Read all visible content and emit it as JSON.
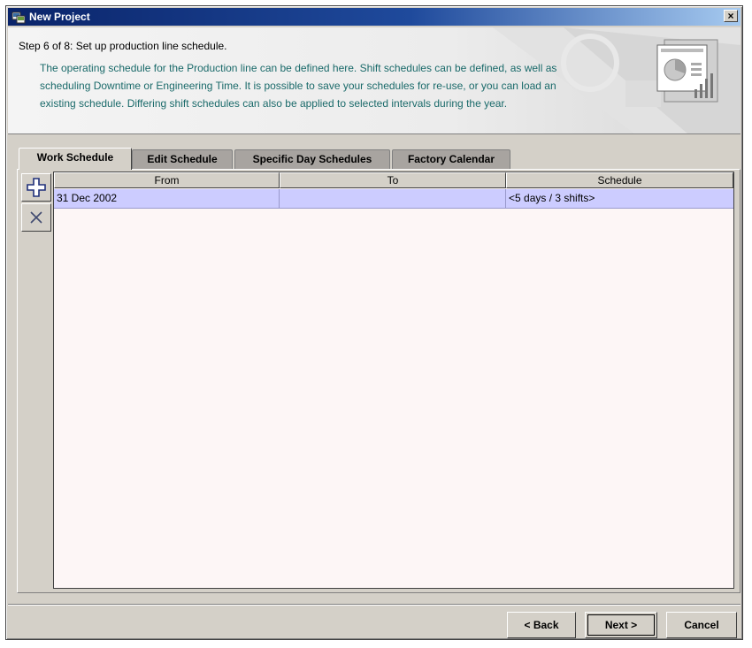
{
  "window": {
    "title": "New Project",
    "close_glyph": "×"
  },
  "header": {
    "step_title": "Step 6 of 8: Set up production line schedule.",
    "description": "The operating schedule for the Production line can be defined here. Shift schedules can be defined, as well as scheduling Downtime or Engineering Time. It is possible to save your schedules for re-use, or you can load an existing schedule. Differing shift schedules can also be applied to selected intervals during the year."
  },
  "tabs": [
    {
      "label": "Work Schedule",
      "active": true
    },
    {
      "label": "Edit Schedule",
      "active": false
    },
    {
      "label": "Specific Day Schedules",
      "active": false
    },
    {
      "label": "Factory Calendar",
      "active": false
    }
  ],
  "toolbar": {
    "add_icon": "plus-icon",
    "delete_icon": "x-icon"
  },
  "table": {
    "columns": [
      "From",
      "To",
      "Schedule"
    ],
    "rows": [
      {
        "from": "31 Dec 2002",
        "to": "",
        "schedule": "<5 days / 3 shifts>",
        "selected": true
      }
    ]
  },
  "buttons": {
    "back": "< Back",
    "next": "Next >",
    "cancel": "Cancel"
  },
  "colors": {
    "title_bar": "#0a246a",
    "description_text": "#1a6a6a",
    "selected_row": "#ccccff",
    "table_background": "#fdf6f6"
  }
}
